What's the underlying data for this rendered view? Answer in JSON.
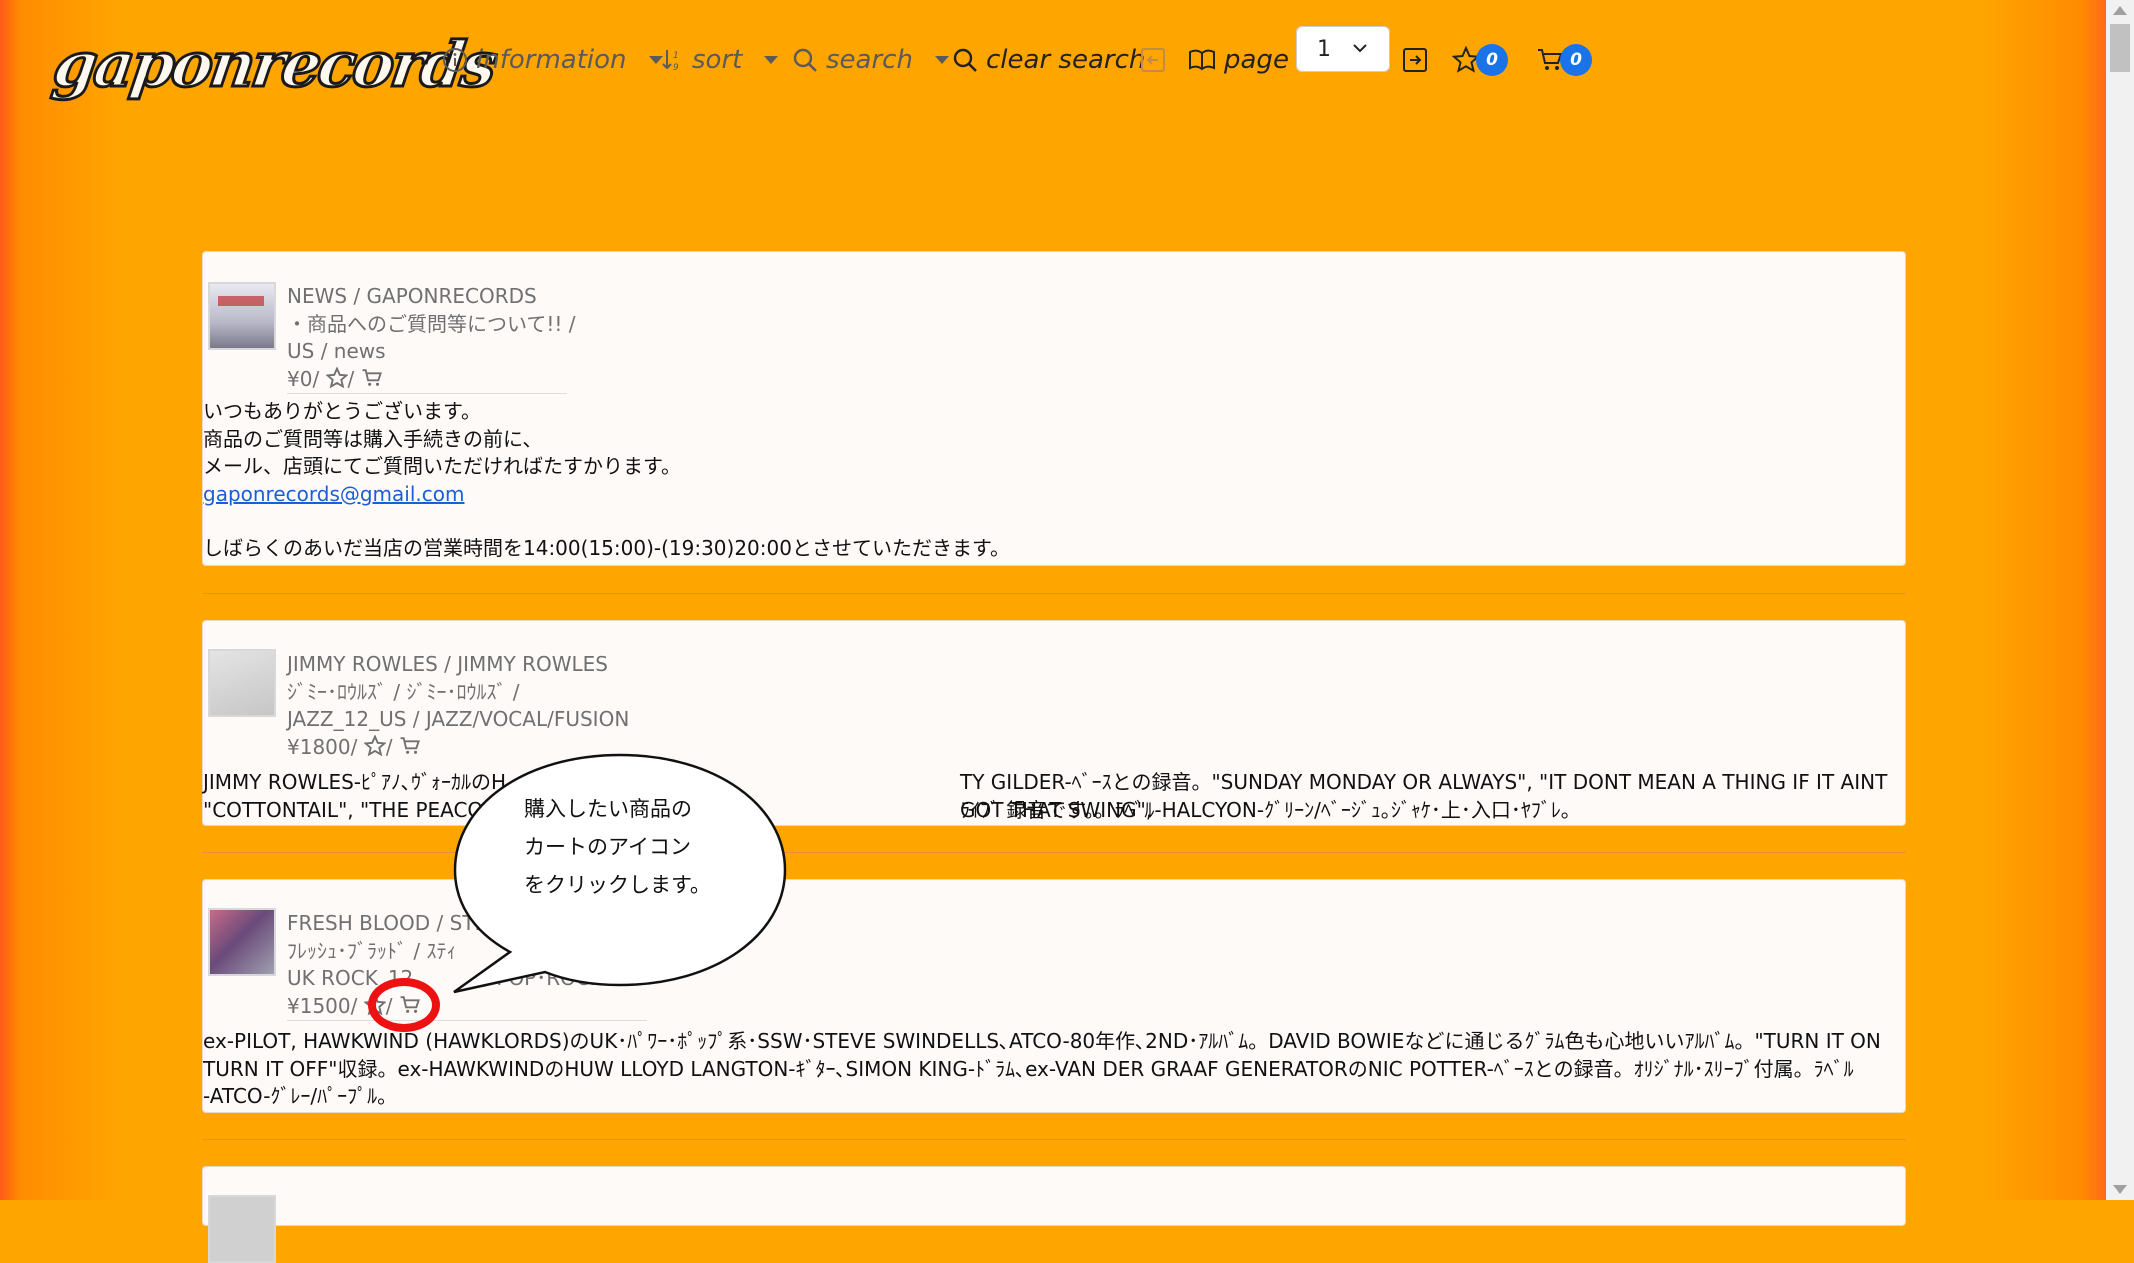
{
  "header": {
    "logo_text": "gaponrecords",
    "nav_information": "information",
    "nav_sort": "sort",
    "nav_search": "search",
    "nav_clear_search": "clear search",
    "nav_page": "page",
    "page_selected": "1",
    "favorites_count": "0",
    "cart_count": "0"
  },
  "items": [
    {
      "title": "NEWS / GAPONRECORDS",
      "subtitle": "・商品へのご質問等について!! /",
      "category": "US / news",
      "price": "¥0/",
      "desc_lines": [
        "いつもありがとうございます。",
        "商品のご質問等は購入手続きの前に、",
        "メール、店頭にてご質問いただければたすかります。"
      ],
      "email": "gaponrecords@gmail.com",
      "desc_after": "しばらくのあいだ当店の営業時間を14:00(15:00)-(19:30)20:00とさせていただきます。"
    },
    {
      "title": "JIMMY ROWLES / JIMMY ROWLES",
      "subtitle": "ｼﾞﾐｰ･ﾛｳﾙｽﾞ / ｼﾞﾐｰ･ﾛｳﾙｽﾞ /",
      "category": "JAZZ_12_US / JAZZ/VOCAL/FUSION",
      "price": "¥1800/",
      "desc_line1_left": "JIMMY ROWLES-ﾋﾟｱﾉ､ｳﾞｫｰｶﾙのH",
      "desc_line1_right": "TY GILDER-ﾍﾞｰｽとの録音。\"SUNDAY MONDAY OR ALWAYS\", \"IT DONT MEAN A THING IF IT AINT GOT THAT SWING\",",
      "desc_line2_left": "\"COTTONTAIL\", \"THE PEACO",
      "desc_line2_right": "ﾗｲﾌﾞ 録音です。。ﾗﾍﾞﾙ-HALCYON-ｸﾞﾘｰﾝ/ﾍﾞｰｼﾞｭ｡ｼﾞｬｹ･上･入口･ﾔﾌﾞﾚ｡"
    },
    {
      "title": "FRESH BLOOD / STEV",
      "subtitle": "ﾌﾚｯｼｭ･ﾌﾞﾗｯﾄﾞ / ｽﾃｨ",
      "category": "UK ROCK_12",
      "category_right": "/ POP･ROCK UK",
      "price": "¥1500/",
      "desc_lines": [
        "ex-PILOT, HAWKWIND (HAWKLORDS)のUK･ﾊﾟﾜｰ･ﾎﾟｯﾌﾟ系･SSW･STEVE SWINDELLS､ATCO-80年作､2ND･ｱﾙﾊﾞﾑ。DAVID BOWIEなどに通じるｸﾞﾗﾑ色も心地いいｱﾙﾊﾞﾑ。\"TURN IT ON",
        "TURN IT OFF\"収録。ex-HAWKWINDのHUW LLOYD LANGTON-ｷﾞﾀｰ､SIMON KING-ﾄﾞﾗﾑ､ex-VAN DER GRAAF GENERATORのNIC POTTER-ﾍﾞｰｽとの録音。ｵﾘｼﾞﾅﾙ･ｽﾘｰﾌﾞ付属。ﾗﾍﾞﾙ",
        "-ATCO-ｸﾞﾚｰ/ﾊﾟｰﾌﾟﾙ。"
      ]
    }
  ],
  "callout": {
    "lines": [
      "購入したい商品の",
      "カートのアイコン",
      "をクリックします。"
    ]
  }
}
